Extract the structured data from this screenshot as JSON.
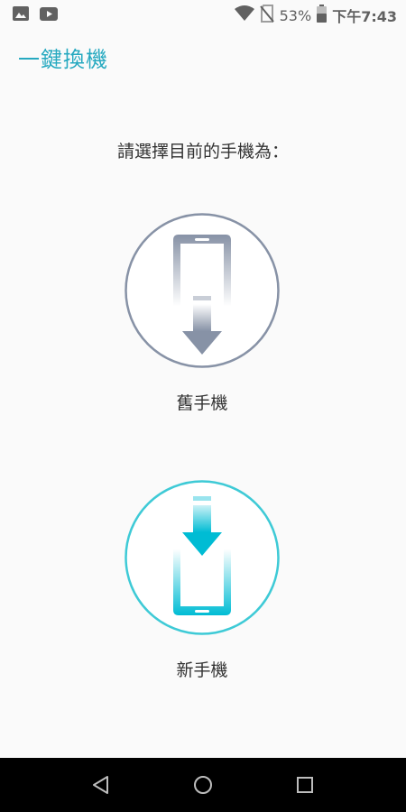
{
  "status_bar": {
    "battery_percent": "53%",
    "time": "下午7:43",
    "icons": [
      "image-icon",
      "youtube-icon",
      "wifi-icon",
      "no-sim-icon",
      "battery-icon"
    ]
  },
  "app_bar": {
    "title": "一鍵換機"
  },
  "main": {
    "prompt": "請選擇目前的手機為：",
    "options": [
      {
        "label": "舊手機",
        "icon": "old-phone-send-icon",
        "color": "#8792a6"
      },
      {
        "label": "新手機",
        "icon": "new-phone-receive-icon",
        "color": "#3ecad6"
      }
    ]
  },
  "nav_bar": {
    "buttons": [
      "back-icon",
      "home-icon",
      "recents-icon"
    ]
  },
  "colors": {
    "accent": "#26a9c0",
    "old_phone": "#8792a6",
    "new_phone": "#3ecad6",
    "new_phone_fill": "#00bcd4"
  }
}
